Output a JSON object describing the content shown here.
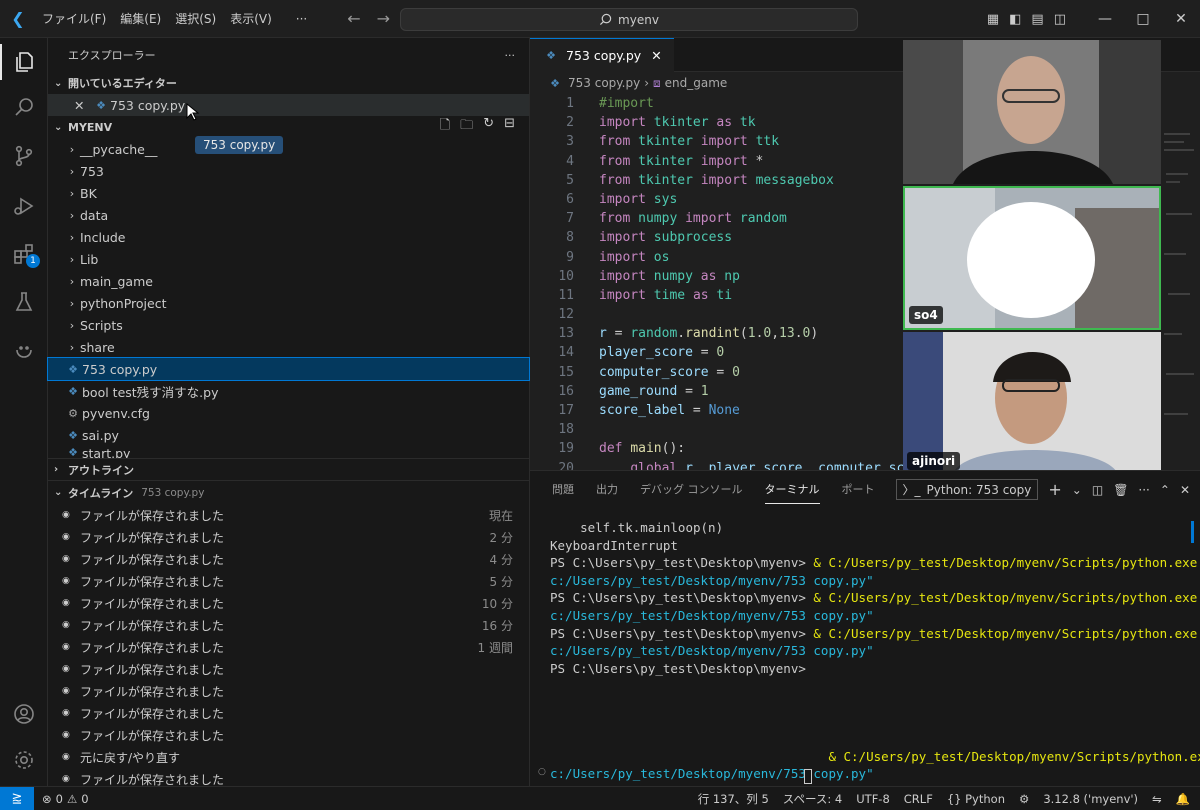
{
  "titlebar": {
    "menu": [
      "ファイル(F)",
      "編集(E)",
      "選択(S)",
      "表示(V)"
    ],
    "more": "···",
    "search": "myenv"
  },
  "sidebar": {
    "title": "エクスプローラー",
    "title_more": "···",
    "open_editors": {
      "label": "開いているエディター",
      "files": [
        {
          "name": "753 copy.py"
        }
      ]
    },
    "drag_tooltip": "753 copy.py",
    "workspace": "MYENV",
    "folders": [
      "__pycache__",
      "753",
      "BK",
      "data",
      "Include",
      "Lib",
      "main_game",
      "pythonProject",
      "Scripts",
      "share"
    ],
    "files": [
      {
        "name": "753 copy.py",
        "icon": "python-icon",
        "selected": true
      },
      {
        "name": "bool test残す消すな.py",
        "icon": "python-icon"
      },
      {
        "name": "pyvenv.cfg",
        "icon": "gear-icon"
      },
      {
        "name": "sai.py",
        "icon": "python-icon"
      },
      {
        "name": "start.py",
        "icon": "python-icon"
      }
    ],
    "outline": "アウトライン",
    "timeline": {
      "label": "タイムライン",
      "file": "753 copy.py",
      "entries": [
        {
          "text": "ファイルが保存されました",
          "time": "現在"
        },
        {
          "text": "ファイルが保存されました",
          "time": "2 分"
        },
        {
          "text": "ファイルが保存されました",
          "time": "4 分"
        },
        {
          "text": "ファイルが保存されました",
          "time": "5 分"
        },
        {
          "text": "ファイルが保存されました",
          "time": "10 分"
        },
        {
          "text": "ファイルが保存されました",
          "time": "16 分"
        },
        {
          "text": "ファイルが保存されました",
          "time": "1 週間"
        },
        {
          "text": "ファイルが保存されました",
          "time": ""
        },
        {
          "text": "ファイルが保存されました",
          "time": ""
        },
        {
          "text": "ファイルが保存されました",
          "time": ""
        },
        {
          "text": "ファイルが保存されました",
          "time": ""
        },
        {
          "text": "元に戻す/やり直す",
          "time": ""
        },
        {
          "text": "ファイルが保存されました",
          "time": ""
        }
      ]
    }
  },
  "editor": {
    "tab": "753 copy.py",
    "breadcrumb": [
      "753 copy.py",
      "end_game"
    ],
    "lines": [
      "#import",
      "import tkinter as tk",
      "from tkinter import ttk",
      "from tkinter import *",
      "from tkinter import messagebox",
      "import sys",
      "from numpy import random",
      "import subprocess",
      "import os",
      "import numpy as np",
      "import time as ti",
      "",
      "r = random.randint(1.0,13.0)",
      "player_score = 0",
      "computer_score = 0",
      "game_round = 1",
      "score_label = None",
      "",
      "def main():",
      "    global r, player_score, computer_sco"
    ]
  },
  "video": {
    "participants": [
      {
        "name": ""
      },
      {
        "name": "so4"
      },
      {
        "name": "ajinori"
      }
    ]
  },
  "panel": {
    "tabs": [
      "問題",
      "出力",
      "デバッグ コンソール",
      "ターミナル",
      "ポート"
    ],
    "active_tab": "ターミナル",
    "terminal_name": "Python: 753 copy",
    "terminal_lines": [
      {
        "a": "    self.tk.mainloop(n)",
        "b": "",
        "c": ""
      },
      {
        "a": "KeyboardInterrupt",
        "b": "",
        "c": ""
      },
      {
        "a": "PS C:\\Users\\py_test\\Desktop\\myenv> ",
        "b": "& C:/Users/py_test/Desktop/myenv/Scripts/python.exe \"",
        "c": ""
      },
      {
        "a": "",
        "b": "",
        "c": "c:/Users/py_test/Desktop/myenv/753 copy.py\""
      },
      {
        "a": "PS C:\\Users\\py_test\\Desktop\\myenv> ",
        "b": "& C:/Users/py_test/Desktop/myenv/Scripts/python.exe \"",
        "c": ""
      },
      {
        "a": "",
        "b": "",
        "c": "c:/Users/py_test/Desktop/myenv/753 copy.py\""
      },
      {
        "a": "PS C:\\Users\\py_test\\Desktop\\myenv> ",
        "b": "& C:/Users/py_test/Desktop/myenv/Scripts/python.exe \"",
        "c": ""
      },
      {
        "a": "",
        "b": "",
        "c": "c:/Users/py_test/Desktop/myenv/753 copy.py\""
      },
      {
        "a": "PS C:\\Users\\py_test\\Desktop\\myenv>",
        "b": "",
        "c": ""
      },
      {
        "a": "",
        "b": "",
        "c": ""
      },
      {
        "a": "",
        "b": "",
        "c": ""
      },
      {
        "a": "",
        "b": "",
        "c": ""
      },
      {
        "a": "",
        "b": "",
        "c": ""
      },
      {
        "a": "                                     ",
        "b": "& C:/Users/py_test/Desktop/myenv/Scripts/python.exe \"",
        "c": ""
      },
      {
        "a": "",
        "b": "",
        "c": "c:/Users/py_test/Desktop/myenv/753 copy.py\""
      },
      {
        "a": "PS C:\\Users\\py_test\\Desktop\\myenv> ",
        "b": "",
        "c": ""
      }
    ]
  },
  "statusbar": {
    "problems": "0",
    "warnings": "0",
    "position": "行 137、列 5",
    "spaces": "スペース: 4",
    "encoding": "UTF-8",
    "eol": "CRLF",
    "language": "Python",
    "interpreter": "3.12.8 ('myenv')"
  }
}
